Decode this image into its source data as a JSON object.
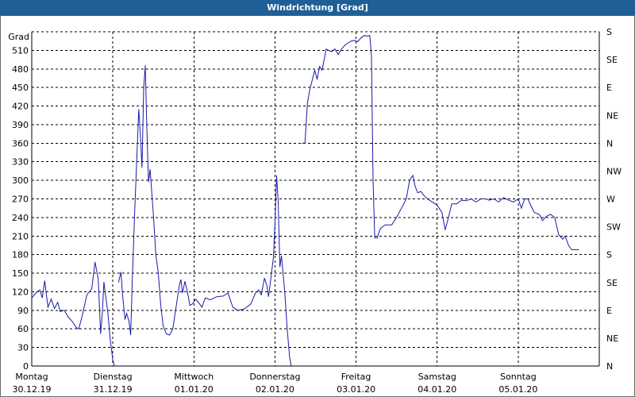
{
  "window": {
    "title": "Windrichtung [Grad]"
  },
  "chart_data": {
    "type": "line",
    "title": "Windrichtung [Grad]",
    "ylabel": "Grad",
    "ylim": [
      0,
      540
    ],
    "y_ticks": [
      0,
      30,
      60,
      90,
      120,
      150,
      180,
      210,
      240,
      270,
      300,
      330,
      360,
      390,
      420,
      450,
      480,
      510
    ],
    "right_axis": {
      "ticks": [
        0,
        45,
        90,
        135,
        180,
        225,
        270,
        315,
        360,
        405,
        450,
        495,
        540
      ],
      "labels": [
        "N",
        "NE",
        "E",
        "SE",
        "S",
        "SW",
        "W",
        "NW",
        "N",
        "NE",
        "E",
        "SE",
        "S"
      ]
    },
    "xlim": [
      0,
      7
    ],
    "days": [
      {
        "name": "Montag",
        "date": "30.12.19"
      },
      {
        "name": "Dienstag",
        "date": "31.12.19"
      },
      {
        "name": "Mittwoch",
        "date": "01.01.20"
      },
      {
        "name": "Donnerstag",
        "date": "02.01.20"
      },
      {
        "name": "Freitag",
        "date": "03.01.20"
      },
      {
        "name": "Samstag",
        "date": "04.01.20"
      },
      {
        "name": "Sonntag",
        "date": "05.01.20"
      }
    ],
    "grid": true,
    "colors": {
      "line": "#1a1aa8",
      "grid": "#000000",
      "axis": "#000000"
    },
    "series": [
      {
        "points": [
          [
            0.0,
            110
          ],
          [
            0.05,
            118
          ],
          [
            0.1,
            123
          ],
          [
            0.13,
            110
          ],
          [
            0.16,
            138
          ],
          [
            0.2,
            95
          ],
          [
            0.24,
            108
          ],
          [
            0.28,
            93
          ],
          [
            0.32,
            103
          ],
          [
            0.35,
            88
          ],
          [
            0.4,
            90
          ],
          [
            0.45,
            79
          ],
          [
            0.5,
            72
          ],
          [
            0.55,
            62
          ],
          [
            0.58,
            60
          ],
          [
            0.62,
            80
          ],
          [
            0.68,
            115
          ],
          [
            0.74,
            125
          ],
          [
            0.78,
            168
          ],
          [
            0.82,
            140
          ],
          [
            0.85,
            52
          ],
          [
            0.87,
            85
          ],
          [
            0.89,
            136
          ],
          [
            0.91,
            115
          ],
          [
            0.94,
            85
          ],
          [
            0.97,
            40
          ],
          [
            1.0,
            10
          ],
          [
            1.02,
            0
          ],
          [
            1.03,
            -5
          ]
        ]
      },
      {
        "points": [
          [
            1.07,
            135
          ],
          [
            1.1,
            152
          ],
          [
            1.12,
            115
          ],
          [
            1.15,
            75
          ],
          [
            1.17,
            85
          ],
          [
            1.2,
            72
          ],
          [
            1.22,
            50
          ],
          [
            1.24,
            140
          ],
          [
            1.27,
            250
          ],
          [
            1.3,
            350
          ],
          [
            1.32,
            415
          ],
          [
            1.34,
            372
          ],
          [
            1.36,
            320
          ],
          [
            1.38,
            448
          ],
          [
            1.4,
            486
          ],
          [
            1.42,
            385
          ],
          [
            1.44,
            297
          ],
          [
            1.46,
            318
          ],
          [
            1.48,
            280
          ],
          [
            1.5,
            245
          ],
          [
            1.53,
            180
          ],
          [
            1.56,
            152
          ],
          [
            1.59,
            100
          ],
          [
            1.62,
            65
          ],
          [
            1.66,
            52
          ],
          [
            1.7,
            50
          ],
          [
            1.74,
            60
          ],
          [
            1.78,
            95
          ],
          [
            1.82,
            130
          ],
          [
            1.84,
            140
          ],
          [
            1.86,
            118
          ],
          [
            1.89,
            137
          ],
          [
            1.92,
            120
          ],
          [
            1.95,
            98
          ],
          [
            1.98,
            100
          ],
          [
            2.02,
            108
          ],
          [
            2.06,
            102
          ],
          [
            2.1,
            95
          ],
          [
            2.14,
            110
          ],
          [
            2.2,
            107
          ],
          [
            2.28,
            112
          ],
          [
            2.36,
            113
          ],
          [
            2.42,
            118
          ],
          [
            2.48,
            95
          ],
          [
            2.54,
            90
          ],
          [
            2.62,
            92
          ],
          [
            2.7,
            100
          ],
          [
            2.76,
            118
          ],
          [
            2.8,
            123
          ],
          [
            2.83,
            115
          ],
          [
            2.87,
            142
          ],
          [
            2.9,
            130
          ],
          [
            2.92,
            112
          ],
          [
            2.95,
            142
          ],
          [
            2.98,
            175
          ],
          [
            3.0,
            230
          ],
          [
            3.02,
            308
          ],
          [
            3.04,
            265
          ],
          [
            3.06,
            160
          ],
          [
            3.08,
            178
          ],
          [
            3.1,
            150
          ],
          [
            3.12,
            120
          ],
          [
            3.15,
            60
          ],
          [
            3.18,
            15
          ],
          [
            3.2,
            0
          ]
        ]
      },
      {
        "points": [
          [
            3.33,
            360
          ],
          [
            3.37,
            360
          ],
          [
            3.4,
            425
          ],
          [
            3.43,
            447
          ],
          [
            3.46,
            462
          ],
          [
            3.49,
            478
          ],
          [
            3.52,
            463
          ],
          [
            3.55,
            484
          ],
          [
            3.58,
            478
          ],
          [
            3.61,
            497
          ],
          [
            3.63,
            512
          ],
          [
            3.66,
            510
          ],
          [
            3.7,
            508
          ],
          [
            3.74,
            512
          ],
          [
            3.78,
            503
          ],
          [
            3.82,
            512
          ],
          [
            3.86,
            518
          ],
          [
            3.9,
            522
          ],
          [
            3.94,
            525
          ],
          [
            3.98,
            526
          ],
          [
            4.02,
            524
          ],
          [
            4.06,
            530
          ],
          [
            4.1,
            534
          ],
          [
            4.14,
            533
          ],
          [
            4.17,
            534
          ],
          [
            4.19,
            500
          ],
          [
            4.21,
            300
          ],
          [
            4.23,
            207
          ],
          [
            4.26,
            207
          ],
          [
            4.3,
            222
          ],
          [
            4.36,
            228
          ],
          [
            4.44,
            228
          ],
          [
            4.5,
            240
          ],
          [
            4.56,
            255
          ],
          [
            4.62,
            270
          ],
          [
            4.66,
            300
          ],
          [
            4.7,
            308
          ],
          [
            4.73,
            290
          ],
          [
            4.76,
            280
          ],
          [
            4.8,
            282
          ],
          [
            4.84,
            275
          ],
          [
            4.88,
            270
          ],
          [
            4.94,
            265
          ],
          [
            5.0,
            260
          ],
          [
            5.06,
            248
          ],
          [
            5.1,
            220
          ],
          [
            5.14,
            240
          ],
          [
            5.18,
            262
          ],
          [
            5.24,
            262
          ],
          [
            5.3,
            268
          ],
          [
            5.36,
            267
          ],
          [
            5.42,
            270
          ],
          [
            5.48,
            265
          ],
          [
            5.54,
            270
          ],
          [
            5.6,
            270
          ],
          [
            5.64,
            268
          ],
          [
            5.7,
            270
          ],
          [
            5.76,
            265
          ],
          [
            5.82,
            272
          ],
          [
            5.88,
            268
          ],
          [
            5.94,
            265
          ],
          [
            6.0,
            270
          ],
          [
            6.04,
            255
          ],
          [
            6.08,
            270
          ],
          [
            6.12,
            270
          ],
          [
            6.16,
            258
          ],
          [
            6.2,
            248
          ],
          [
            6.26,
            245
          ],
          [
            6.3,
            235
          ],
          [
            6.35,
            242
          ],
          [
            6.4,
            245
          ],
          [
            6.45,
            240
          ],
          [
            6.5,
            212
          ],
          [
            6.55,
            205
          ],
          [
            6.58,
            210
          ],
          [
            6.62,
            195
          ],
          [
            6.66,
            188
          ],
          [
            6.7,
            188
          ],
          [
            6.75,
            188
          ]
        ]
      }
    ]
  }
}
